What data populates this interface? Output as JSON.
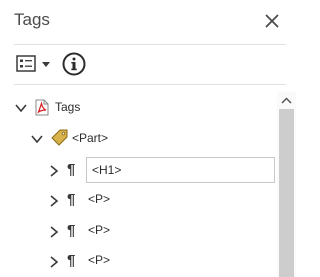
{
  "panel": {
    "title": "Tags",
    "close_icon": "close-icon"
  },
  "toolbar": {
    "options_icon": "options-menu-icon",
    "info_icon": "info-icon"
  },
  "tree": {
    "root": {
      "label": "Tags",
      "icon": "pdf-file-icon",
      "expanded": true
    },
    "part": {
      "label": "<Part>",
      "icon": "tag-icon",
      "expanded": true
    },
    "children": [
      {
        "label": "<H1>",
        "icon": "paragraph-icon",
        "editing": true
      },
      {
        "label": "<P>",
        "icon": "paragraph-icon"
      },
      {
        "label": "<P>",
        "icon": "paragraph-icon"
      },
      {
        "label": "<P>",
        "icon": "paragraph-icon"
      }
    ]
  },
  "colors": {
    "pdf_red": "#d71f26",
    "tag_gold": "#c9a33a",
    "scroll_thumb": "#cdcdcd"
  }
}
